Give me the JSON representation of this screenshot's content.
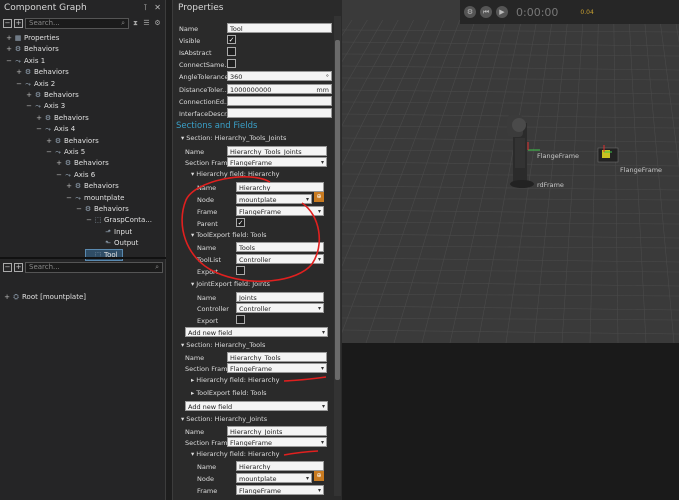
{
  "component_graph": {
    "title": "Component Graph",
    "search_placeholder": "Search...",
    "tree": [
      {
        "label": "Properties",
        "indent": 0,
        "expander": "+",
        "icon": "properties-icon"
      },
      {
        "label": "Behaviors",
        "indent": 0,
        "expander": "+",
        "icon": "behaviors-icon"
      },
      {
        "label": "Axis 1",
        "indent": 0,
        "expander": "−",
        "icon": "axis-icon"
      },
      {
        "label": "Behaviors",
        "indent": 1,
        "expander": "+",
        "icon": "behaviors-icon"
      },
      {
        "label": "Axis 2",
        "indent": 1,
        "expander": "−",
        "icon": "axis-icon"
      },
      {
        "label": "Behaviors",
        "indent": 2,
        "expander": "+",
        "icon": "behaviors-icon"
      },
      {
        "label": "Axis 3",
        "indent": 2,
        "expander": "−",
        "icon": "axis-icon"
      },
      {
        "label": "Behaviors",
        "indent": 3,
        "expander": "+",
        "icon": "behaviors-icon"
      },
      {
        "label": "Axis 4",
        "indent": 3,
        "expander": "−",
        "icon": "axis-icon"
      },
      {
        "label": "Behaviors",
        "indent": 4,
        "expander": "+",
        "icon": "behaviors-icon"
      },
      {
        "label": "Axis 5",
        "indent": 4,
        "expander": "−",
        "icon": "axis-icon"
      },
      {
        "label": "Behaviors",
        "indent": 5,
        "expander": "+",
        "icon": "behaviors-icon"
      },
      {
        "label": "Axis 6",
        "indent": 5,
        "expander": "−",
        "icon": "axis-icon"
      },
      {
        "label": "Behaviors",
        "indent": 6,
        "expander": "+",
        "icon": "behaviors-icon"
      },
      {
        "label": "mountplate",
        "indent": 6,
        "expander": "−",
        "icon": "axis-icon"
      },
      {
        "label": "Behaviors",
        "indent": 7,
        "expander": "−",
        "icon": "behaviors-icon"
      },
      {
        "label": "GraspConta...",
        "indent": 8,
        "expander": "−",
        "icon": "grasp-icon"
      },
      {
        "label": "Input",
        "indent": 9,
        "expander": "",
        "icon": "input-icon"
      },
      {
        "label": "Output",
        "indent": 9,
        "expander": "",
        "icon": "output-icon"
      },
      {
        "label": "Tool",
        "indent": 8,
        "expander": "",
        "icon": "tool-icon",
        "selected": true
      }
    ]
  },
  "hierarchy_panel": {
    "search_placeholder": "Search...",
    "root_label": "Root [mountplate]"
  },
  "properties": {
    "title": "Properties",
    "name_label": "Name",
    "name_value": "Tool",
    "visible_label": "Visible",
    "isabstract_label": "IsAbstract",
    "connectsame_label": "ConnectSame...",
    "angletol_label": "AngleTolerance",
    "angletol_value": "360",
    "angletol_unit": "°",
    "disttol_label": "DistanceToler...",
    "disttol_value": "1000000000",
    "disttol_unit": "mm",
    "connected_label": "ConnectionEd...",
    "interface_label": "InterfaceDescr...",
    "sections_header": "Sections and Fields",
    "s1": {
      "title": "Section: Hierarchy_Tools_Joints",
      "name_label": "Name",
      "name_value": "Hierarchy_Tools_Joints",
      "frame_label": "Section Frame",
      "frame_value": "FlangeFrame",
      "hier_title": "Hierarchy field: Hierarchy",
      "hier_name_label": "Name",
      "hier_name_value": "Hierarchy",
      "hier_node_label": "Node",
      "hier_node_value": "mountplate",
      "hier_frame_label": "Frame",
      "hier_frame_value": "FlangeFrame",
      "hier_parent_label": "Parent",
      "tool_title": "ToolExport field: Tools",
      "tool_name_label": "Name",
      "tool_name_value": "Tools",
      "tool_list_label": "ToolList",
      "tool_list_value": "Controller",
      "tool_export_label": "Export",
      "joint_title": "JointExport field: Joints",
      "joint_name_label": "Name",
      "joint_name_value": "Joints",
      "joint_ctrl_label": "Controller",
      "joint_ctrl_value": "Controller",
      "joint_export_label": "Export",
      "add_field": "Add new field"
    },
    "s2": {
      "title": "Section: Hierarchy_Tools",
      "name_label": "Name",
      "name_value": "Hierarchy_Tools",
      "frame_label": "Section Frame",
      "frame_value": "FlangeFrame",
      "hier_title": "Hierarchy field: Hierarchy",
      "tool_title": "ToolExport field: Tools",
      "add_field": "Add new field"
    },
    "s3": {
      "title": "Section: Hierarchy_Joints",
      "name_label": "Name",
      "name_value": "Hierarchy_Joints",
      "frame_label": "Section Frame",
      "frame_value": "FlangeFrame",
      "hier_title": "Hierarchy field: Hierarchy",
      "hier_name_label": "Name",
      "hier_name_value": "Hierarchy",
      "hier_node_label": "Node",
      "hier_node_value": "mountplate",
      "hier_frame_label": "Frame",
      "hier_frame_value": "FlangeFrame"
    }
  },
  "viewport": {
    "time": "0:00:00",
    "time_small": "0.04",
    "label_flange": "FlangeFrame",
    "label_flange2": "FlangeFrame",
    "label_frame": "rdFrame"
  },
  "colors": {
    "accent": "#3aa0c8",
    "annotation": "#e0201f",
    "selection": "#2f4d66"
  }
}
